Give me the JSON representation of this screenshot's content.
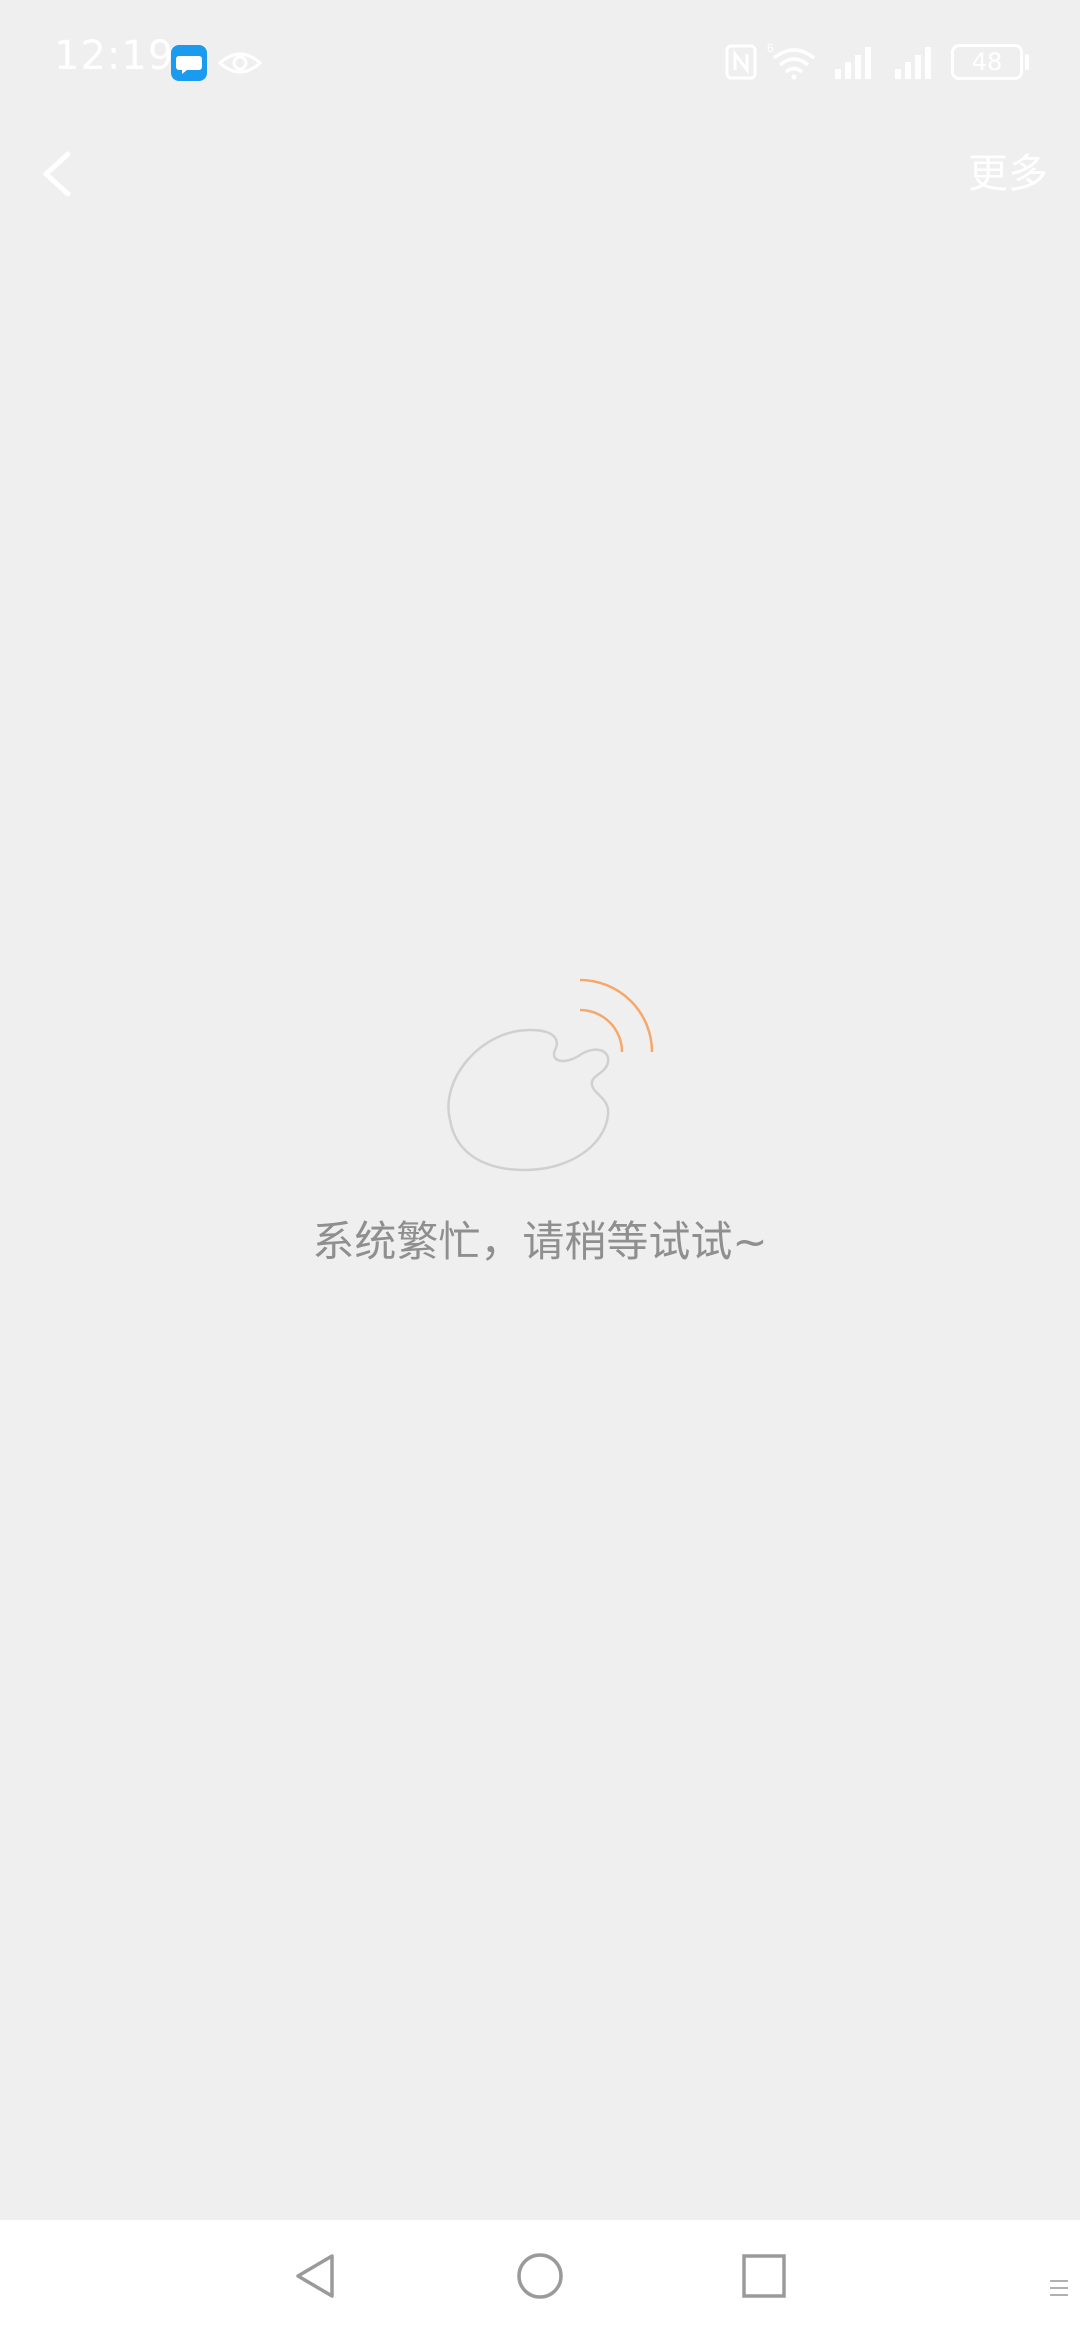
{
  "status_bar": {
    "time": "12:19",
    "battery_level": "48",
    "icons": [
      "message-app-icon",
      "eye-icon",
      "nfc-icon",
      "wifi-6-icon",
      "signal-icon",
      "signal-icon"
    ],
    "wifi_badge": "6"
  },
  "header": {
    "back_icon": "chevron-left-icon",
    "more_label": "更多"
  },
  "empty_state": {
    "illustration": "broken-signal-hand-illustration",
    "message": "系统繁忙，请稍等试试~",
    "accent_color": "#f5a86c"
  },
  "system_nav": {
    "items": [
      "back-triangle-icon",
      "home-circle-icon",
      "recents-square-icon"
    ]
  },
  "colors": {
    "background": "#efefef",
    "nav_background": "#ffffff",
    "message_text": "#8f8f8f"
  }
}
